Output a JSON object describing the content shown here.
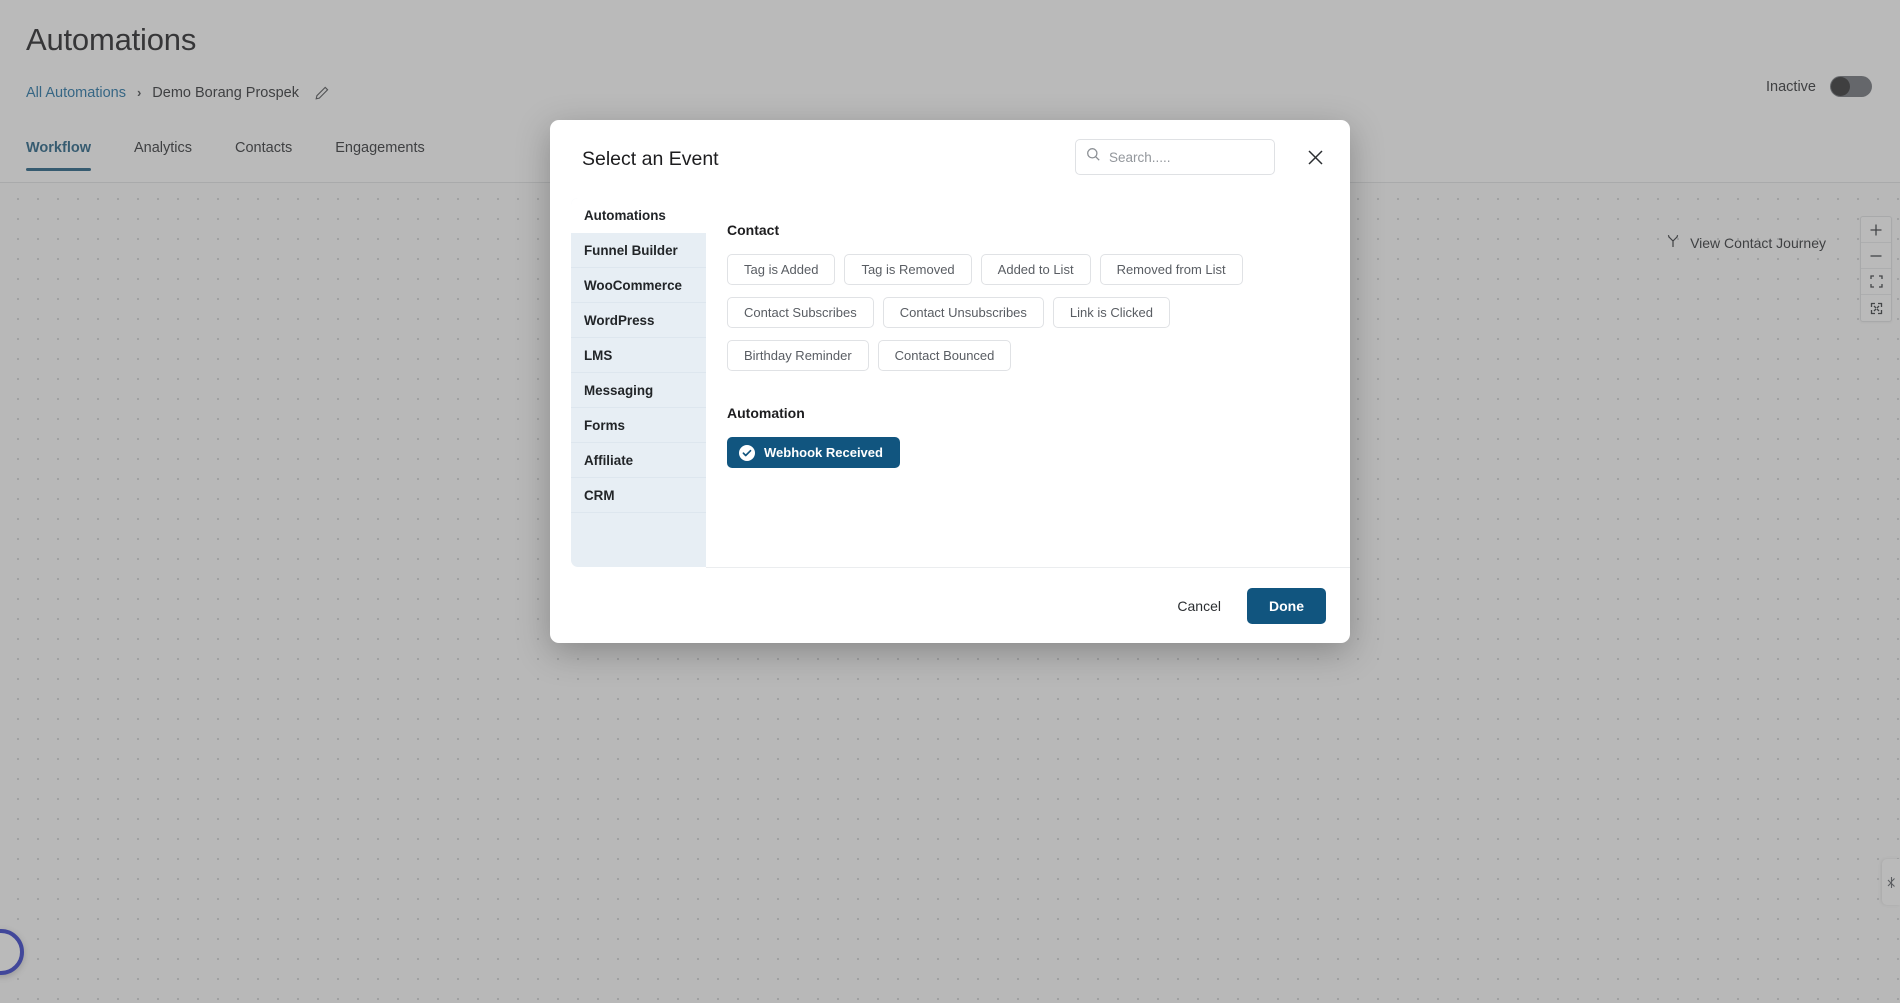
{
  "header": {
    "title": "Automations",
    "breadcrumb": {
      "root": "All Automations",
      "separator": "›",
      "current": "Demo Borang Prospek",
      "edit_icon": "pencil-icon"
    },
    "status_label": "Inactive",
    "toggle_state": "off",
    "tabs": [
      {
        "label": "Workflow",
        "active": true
      },
      {
        "label": "Analytics",
        "active": false
      },
      {
        "label": "Contacts",
        "active": false
      },
      {
        "label": "Engagements",
        "active": false
      }
    ]
  },
  "canvas": {
    "journey_button": "View Contact Journey",
    "journey_icon": "branch-icon",
    "zoom_controls": [
      {
        "name": "zoom-in",
        "glyph": "+"
      },
      {
        "name": "zoom-out",
        "glyph": "−"
      },
      {
        "name": "fit-view",
        "glyph": "fit-icon"
      },
      {
        "name": "fullscreen",
        "glyph": "expand-icon"
      }
    ],
    "side_handle_icon": "panel-toggle-icon",
    "chat_bubble_icon": "chat-icon"
  },
  "modal": {
    "title": "Select an Event",
    "search": {
      "value": "",
      "placeholder": "Search....."
    },
    "close_icon": "close-icon",
    "categories": [
      {
        "label": "Automations",
        "active": true
      },
      {
        "label": "Funnel Builder",
        "active": false
      },
      {
        "label": "WooCommerce",
        "active": false
      },
      {
        "label": "WordPress",
        "active": false
      },
      {
        "label": "LMS",
        "active": false
      },
      {
        "label": "Messaging",
        "active": false
      },
      {
        "label": "Forms",
        "active": false
      },
      {
        "label": "Affiliate",
        "active": false
      },
      {
        "label": "CRM",
        "active": false
      }
    ],
    "groups": [
      {
        "title": "Contact",
        "chips": [
          {
            "label": "Tag is Added",
            "selected": false
          },
          {
            "label": "Tag is Removed",
            "selected": false
          },
          {
            "label": "Added to List",
            "selected": false
          },
          {
            "label": "Removed from List",
            "selected": false
          },
          {
            "label": "Contact Subscribes",
            "selected": false
          },
          {
            "label": "Contact Unsubscribes",
            "selected": false
          },
          {
            "label": "Link is Clicked",
            "selected": false
          },
          {
            "label": "Birthday Reminder",
            "selected": false
          },
          {
            "label": "Contact Bounced",
            "selected": false
          }
        ]
      },
      {
        "title": "Automation",
        "chips": [
          {
            "label": "Webhook Received",
            "selected": true,
            "icon": "check-circle-icon"
          }
        ]
      }
    ],
    "footer": {
      "cancel": "Cancel",
      "done": "Done"
    }
  },
  "colors": {
    "accent": "#11557f",
    "tab_active": "#1d5c80",
    "link": "#1d6fa3",
    "sidebar_bg": "#e7eef4",
    "chat_ring": "#2f39c9"
  }
}
